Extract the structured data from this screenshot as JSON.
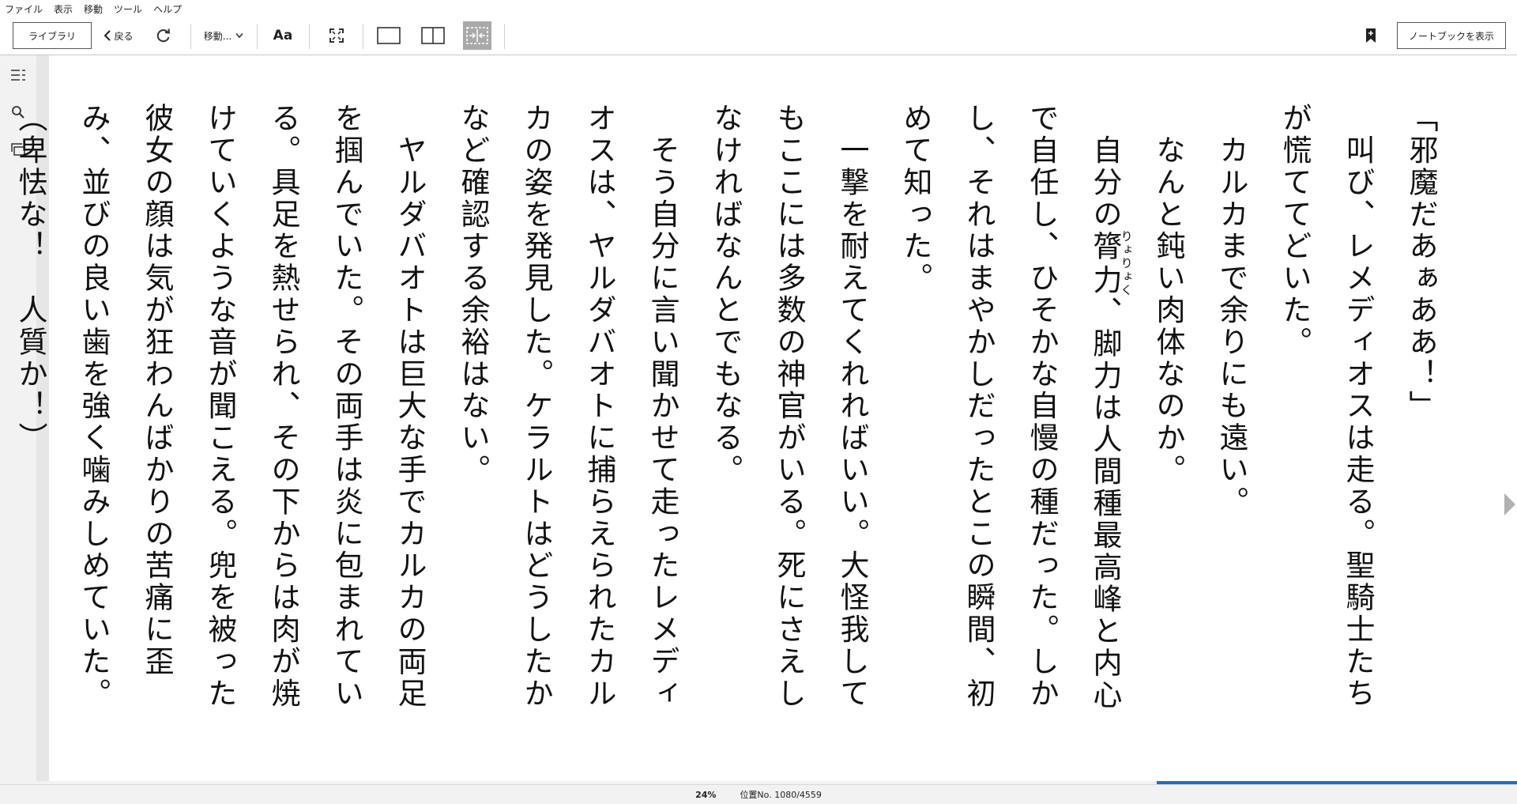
{
  "menu": {
    "file": "ファイル",
    "view": "表示",
    "go": "移動",
    "tools": "ツール",
    "help": "ヘルプ"
  },
  "toolbar": {
    "library": "ライブラリ",
    "back": "戻る",
    "goto": "移動...",
    "font": "Aa",
    "notebook": "ノートブックを表示"
  },
  "icons": {
    "back": "chevron-left-icon",
    "refresh": "refresh-icon",
    "goto_dropdown": "chevron-down-icon",
    "fullscreen": "fullscreen-icon",
    "single_page": "single-page-icon",
    "two_page": "two-page-icon",
    "fit_width": "fit-width-icon",
    "bookmark": "bookmark-add-icon",
    "toc": "toc-icon",
    "search": "search-icon",
    "flashcards": "flashcards-icon",
    "next_page": "next-page-icon"
  },
  "book": {
    "paragraphs": [
      "「邪魔だあぁああ！」",
      "　叫び、レメディオスは走る。聖騎士たちが慌ててどいた。",
      "　カルカまで余りにも遠い。",
      "　なんと鈍い肉体なのか。",
      "@RUBY@",
      "　一撃を耐えてくれればいい。大怪我してもここには多数の神官がいる。死にさえしなければなんとでもなる。",
      "　そう自分に言い聞かせて走ったレメディオスは、ヤルダバオトに捕らえられたカルカの姿を発見した。ケラルトはどうしたかなど確認する余裕はない。",
      "　ヤルダバオトは巨大な手でカルカの両足を掴んでいた。その両手は炎に包まれている。具足を熱せられ、その下からは肉が焼けていくような音が聞こえる。兜を被った彼女の顔は気が狂わんばかりの苦痛に歪み、並びの良い歯を強く噛みしめていた。",
      "（卑怯な！　人質か！）"
    ],
    "ruby_paragraph": {
      "before": "　自分の",
      "base": "膂力",
      "ruby": "りょりょく",
      "after": "、脚力は人間種最高峰と内心で自任し、ひそかな自慢の種だった。しかし、それはまやかしだったとこの瞬間、初めて知った。"
    }
  },
  "status": {
    "percent": "24%",
    "location": "位置No. 1080/4559",
    "progress_fraction": 0.24
  },
  "colors": {
    "progress": "#1f6fbf",
    "active_toggle": "#a9a9a9"
  }
}
